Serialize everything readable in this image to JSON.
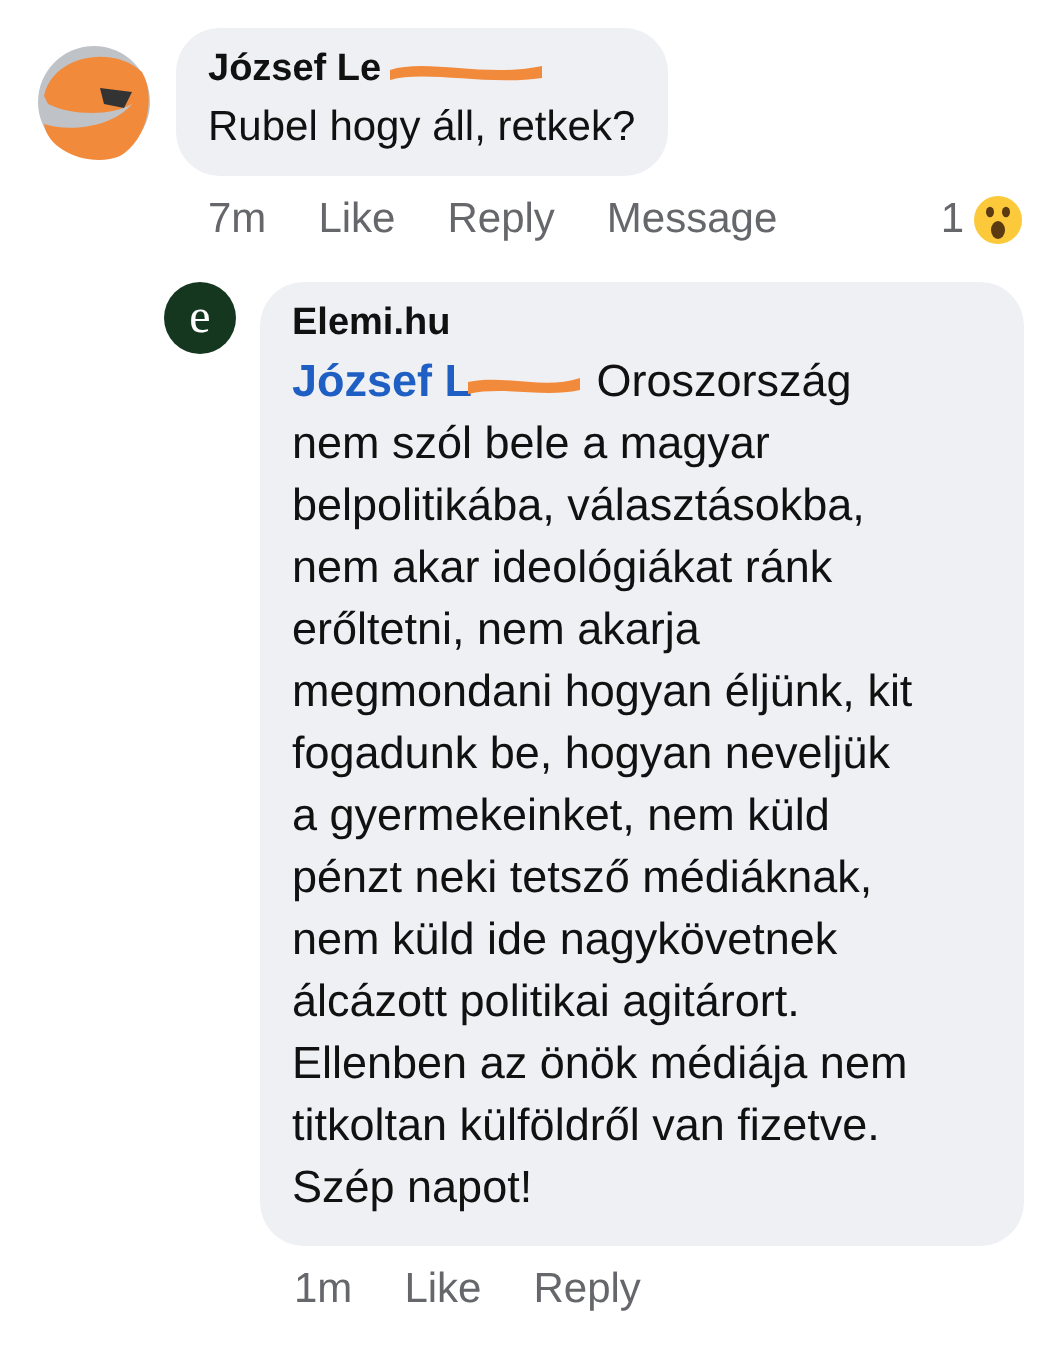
{
  "comments": [
    {
      "author": "József Le",
      "redacted": true,
      "avatar": {
        "kind": "redacted"
      },
      "text": "Rubel hogy áll, retkek?",
      "actions": {
        "time": "7m",
        "like": "Like",
        "reply": "Reply",
        "message": "Message"
      },
      "reactions": {
        "count": "1",
        "kind": "wow"
      },
      "replies": [
        {
          "author": "Elemi.hu",
          "avatar": {
            "kind": "logo",
            "letter": "e"
          },
          "mention": "József L",
          "mention_redacted": true,
          "text": "Oroszország nem szól bele a magyar belpolitikába, választásokba, nem akar ideológiákat ránk erőltetni, nem akarja megmondani hogyan éljünk, kit fogadunk be, hogyan neveljük a gyermekeinket, nem küld pénzt neki tetsző médiáknak, nem küld ide nagykövetnek álcázott politikai agitárort. Ellenben az önök médiája nem titkoltan külföldről van fizetve. Szép napot!",
          "actions": {
            "time": "1m",
            "like": "Like",
            "reply": "Reply"
          }
        }
      ]
    }
  ]
}
